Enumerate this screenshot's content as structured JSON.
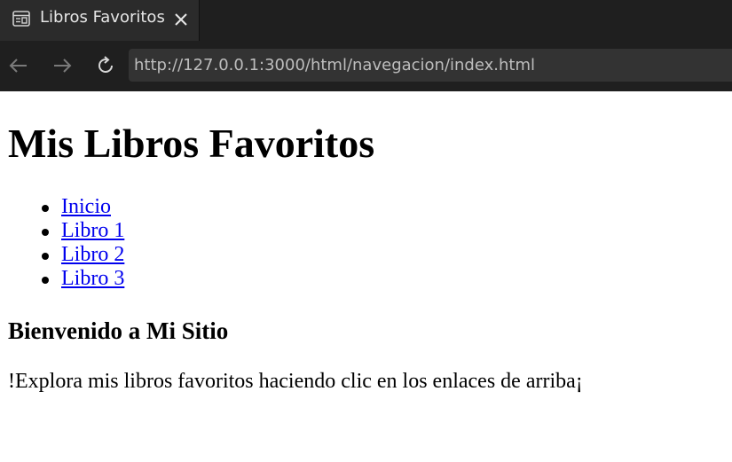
{
  "browser": {
    "tab_title": "Libros Favoritos",
    "url": "http://127.0.0.1:3000/html/navegacion/index.html",
    "icons": {
      "tab": "page-icon",
      "close": "close-icon",
      "back": "back-arrow-icon",
      "forward": "forward-arrow-icon",
      "reload": "reload-icon"
    },
    "colors": {
      "chrome_bg": "#1f1f1f",
      "tab_bg": "#2b2b2b",
      "url_bg": "#333333",
      "url_text": "#bdbdbd"
    }
  },
  "page": {
    "heading": "Mis Libros Favoritos",
    "nav_links": [
      {
        "label": "Inicio"
      },
      {
        "label": "Libro 1"
      },
      {
        "label": "Libro 2"
      },
      {
        "label": "Libro 3"
      }
    ],
    "subheading": "Bienvenido a Mi Sitio",
    "paragraph": "!Explora mis libros favoritos haciendo clic en los enlaces de arriba¡",
    "colors": {
      "link": "#0000ee",
      "text": "#000000"
    }
  }
}
